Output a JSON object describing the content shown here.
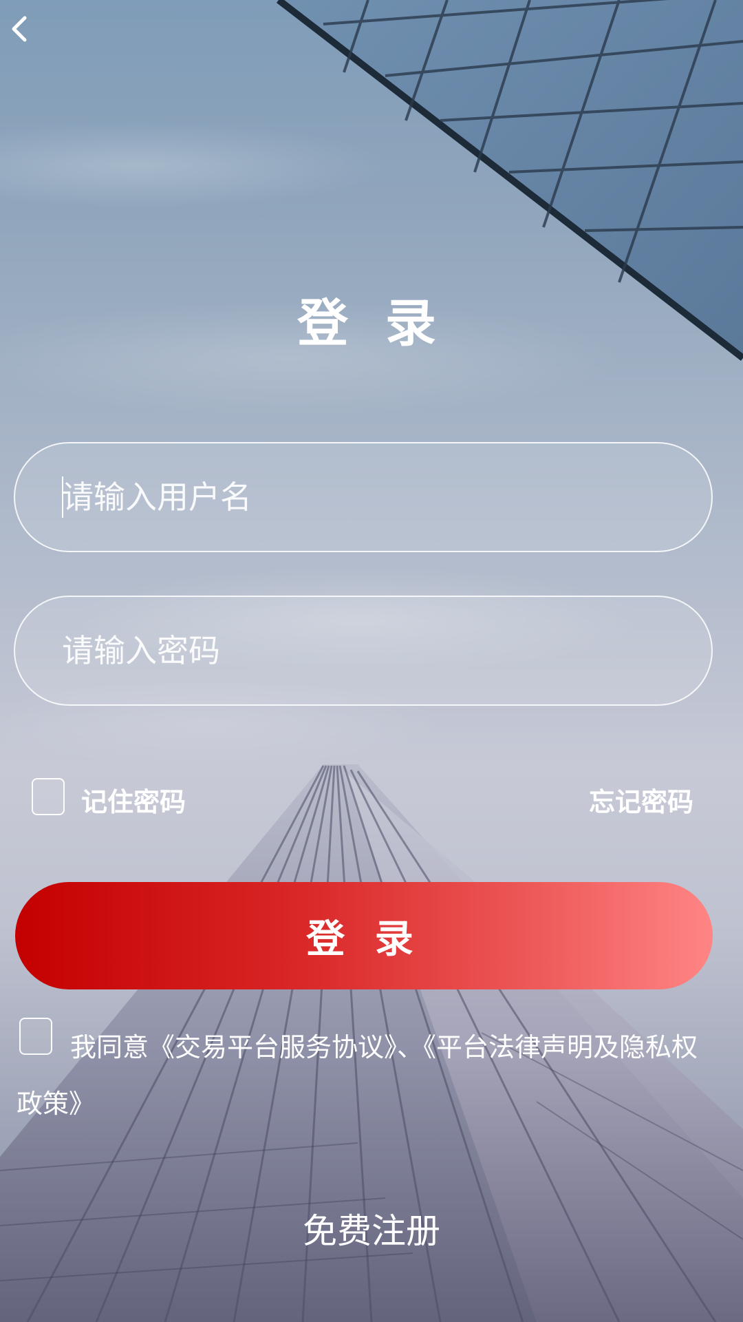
{
  "header": {
    "back_icon": "chevron-left-icon",
    "title": "登 录"
  },
  "form": {
    "username_placeholder": "请输入用户名",
    "password_placeholder": "请输入密码",
    "remember_label": "记住密码",
    "forgot_label": "忘记密码",
    "login_label": "登 录"
  },
  "agreement": {
    "prefix": "我同意",
    "service_link": "《交易平台服务协议》",
    "separator": "、",
    "privacy_link": "《平台法律声明及隐私权政策》"
  },
  "register_label": "免费注册",
  "colors": {
    "button_start": "#c40000",
    "button_end": "#ff8585",
    "text": "#ffffff"
  }
}
